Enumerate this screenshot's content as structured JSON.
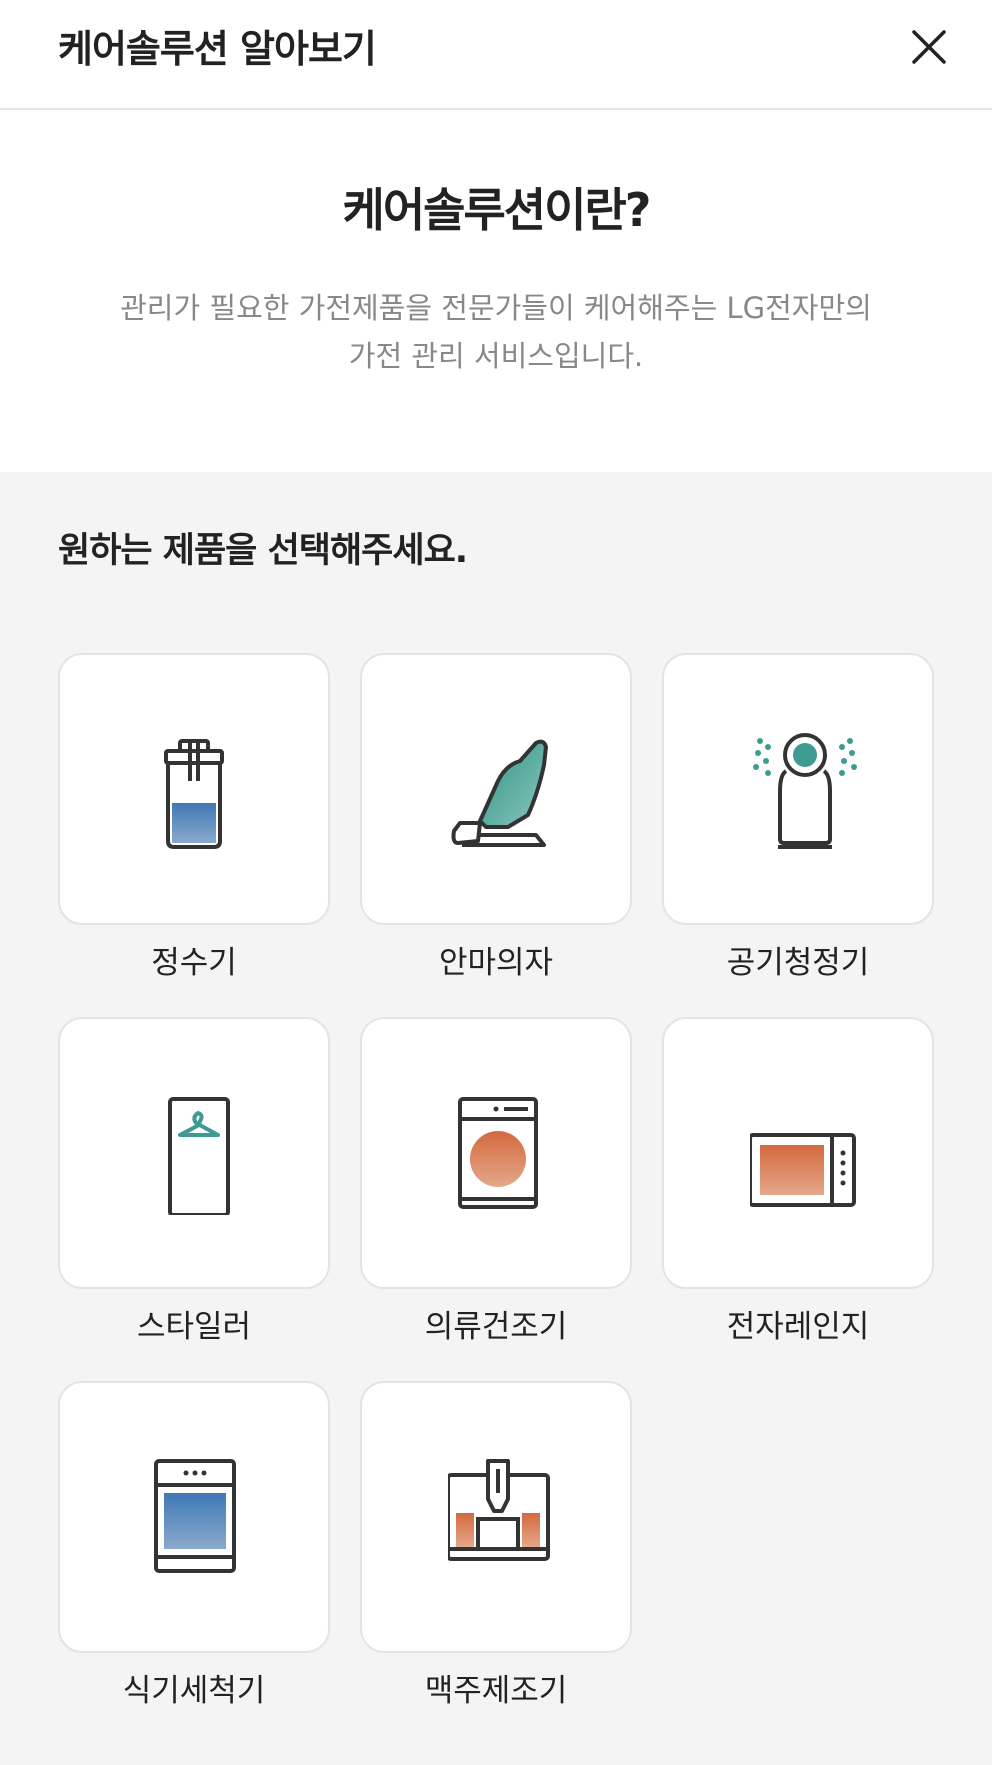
{
  "header": {
    "title": "케어솔루션 알아보기",
    "close_icon": "close-icon"
  },
  "intro": {
    "title": "케어솔루션이란?",
    "desc_line1": "관리가 필요한 가전제품을 전문가들이 케어해주는 LG전자만의",
    "desc_line2": "가전 관리 서비스입니다."
  },
  "products": {
    "title": "원하는 제품을 선택해주세요.",
    "items": [
      {
        "label": "정수기",
        "icon": "water-purifier-icon"
      },
      {
        "label": "안마의자",
        "icon": "massage-chair-icon"
      },
      {
        "label": "공기청정기",
        "icon": "air-purifier-icon"
      },
      {
        "label": "스타일러",
        "icon": "styler-icon"
      },
      {
        "label": "의류건조기",
        "icon": "clothes-dryer-icon"
      },
      {
        "label": "전자레인지",
        "icon": "microwave-icon"
      },
      {
        "label": "식기세척기",
        "icon": "dishwasher-icon"
      },
      {
        "label": "맥주제조기",
        "icon": "beer-maker-icon"
      }
    ]
  },
  "colors": {
    "teal": "#3d9b92",
    "blue": "#4c7fb4",
    "orange": "#d87352",
    "outline": "#333333"
  }
}
